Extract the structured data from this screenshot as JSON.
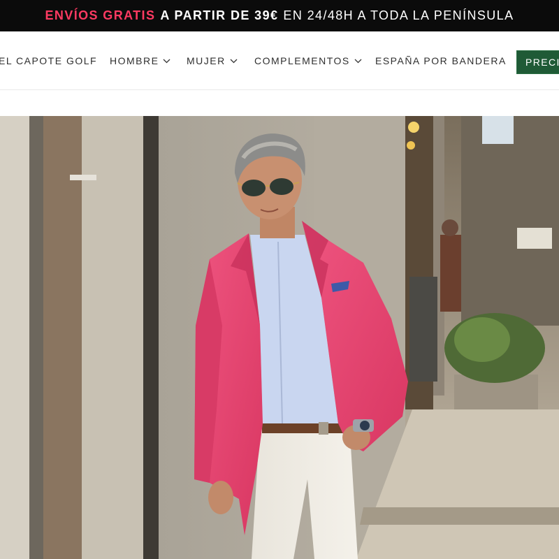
{
  "promo": {
    "part1": "ENVÍOS GRATIS",
    "part2": "A PARTIR DE 39€",
    "part3": "EN 24/48H A TODA LA PENÍNSULA"
  },
  "nav": {
    "items": [
      {
        "label": "EL CAPOTE GOLF",
        "has_dropdown": false
      },
      {
        "label": "HOMBRE",
        "has_dropdown": true
      },
      {
        "label": "MUJER",
        "has_dropdown": true
      },
      {
        "label": "COMPLEMENTOS",
        "has_dropdown": true
      },
      {
        "label": "ESPAÑA POR BANDERA",
        "has_dropdown": false
      }
    ],
    "cta_label": "PRECIO"
  },
  "hero": {
    "icon": "hero-photo"
  },
  "colors": {
    "promo_bg": "#0b0b0b",
    "promo_highlight": "#ff3a62",
    "cta_bg": "#1f5a36",
    "blazer": "#e84470"
  }
}
